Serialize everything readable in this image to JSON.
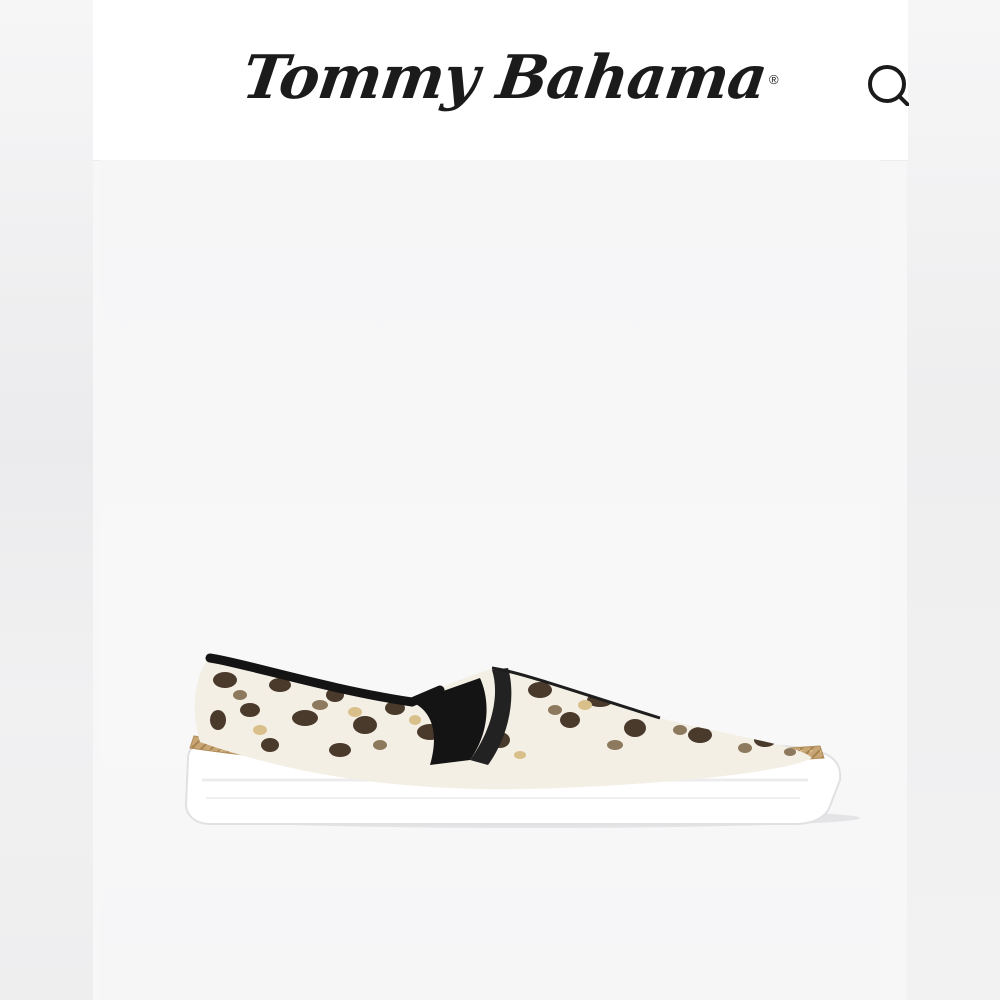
{
  "header": {
    "brand_logo": "Tommy Bahama",
    "registered_mark": "®",
    "search_icon": "search-icon"
  },
  "product": {
    "image": "leopard-print-slip-on-sneaker",
    "colors": {
      "upper_base": "#f4efe4",
      "spot_dark": "#4a3a2c",
      "spot_mid": "#8d7a5e",
      "spot_tan": "#d9c08a",
      "trim": "#141414",
      "jute": "#c8a574",
      "sole": "#ffffff"
    }
  }
}
